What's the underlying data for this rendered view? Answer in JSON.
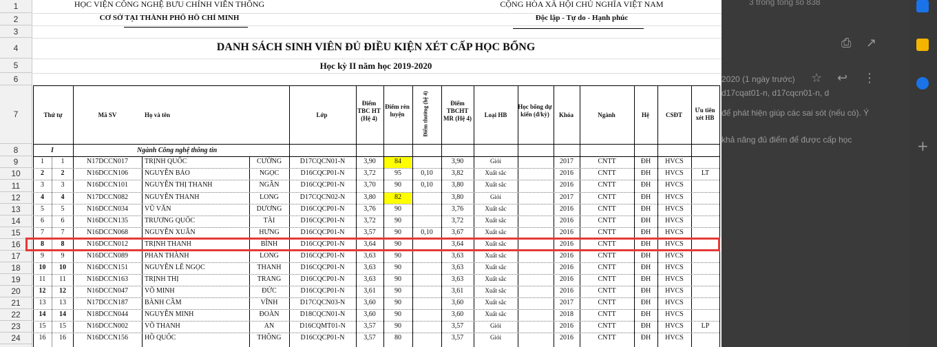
{
  "background": {
    "count_text": "3 trong tổng số 838",
    "date_text": "2020 (1 ngày trước)",
    "recipients_text": "d17cqat01-n, d17cqcn01-n, d",
    "body_line_1": "để phát hiện giúp các sai sót (nếu có). Ý",
    "body_line_2": "khả năng đủ điểm để được cấp học"
  },
  "header": {
    "left_line1": "HỌC VIỆN CÔNG NGHỆ BƯU CHÍNH VIỄN THÔNG",
    "left_line2": "CƠ SỞ TẠI THÀNH PHỐ HỒ CHÍ MINH",
    "right_line1": "CỘNG HÒA XÃ HỘI CHỦ NGHĨA VIỆT NAM",
    "right_line2": "Độc lập - Tự do - Hạnh phúc",
    "title": "DANH SÁCH SINH VIÊN ĐỦ ĐIỀU KIỆN XÉT CẤP HỌC BỔNG",
    "subtitle": "Học kỳ II năm học 2019-2020"
  },
  "row_numbers": [
    "1",
    "2",
    "3",
    "4",
    "5",
    "6",
    "7",
    "8",
    "9",
    "10",
    "11",
    "12",
    "13",
    "14",
    "15",
    "16",
    "17",
    "18",
    "19",
    "20",
    "21",
    "22",
    "23",
    "24"
  ],
  "columns": {
    "stt": "Thứ tự",
    "masv": "Mã SV",
    "hoten": "Họ và tên",
    "lop": "Lớp",
    "diem_tbc": "Điểm TBC HT (Hệ 4)",
    "diem_rl": "Điểm rèn luyện",
    "diem_thuong": "Điểm thưởng (hệ 4)",
    "tbcht": "Điểm TBCHT MR (Hệ 4)",
    "loaihb": "Loại HB",
    "hocbong": "Học bổng dự kiến (đ/kỳ)",
    "khoa": "Khóa",
    "nganh": "Ngành",
    "he": "Hệ",
    "csdt": "CSĐT",
    "uutien": "Ưu tiên xét HB"
  },
  "group_row": {
    "index": "I",
    "label": "Ngành Công nghệ thông tin"
  },
  "rows": [
    {
      "a": "1",
      "b": "1",
      "masv": "N17DCCN017",
      "ho": "TRỊNH QUỐC",
      "ten": "CƯỜNG",
      "lop": "D17CQCN01-N",
      "tbc": "3,90",
      "rl": "84",
      "thuong": "",
      "mr": "3,90",
      "loai": "Giỏi",
      "khoa": "2017",
      "nganh": "CNTT",
      "he": "ĐH",
      "cs": "HVCS",
      "ut": ""
    },
    {
      "a": "2",
      "b": "2",
      "masv": "N16DCCN106",
      "ho": "NGUYỄN BẢO",
      "ten": "NGỌC",
      "lop": "D16CQCP01-N",
      "tbc": "3,72",
      "rl": "95",
      "thuong": "0,10",
      "mr": "3,82",
      "loai": "Xuất sắc",
      "khoa": "2016",
      "nganh": "CNTT",
      "he": "ĐH",
      "cs": "HVCS",
      "ut": "LT"
    },
    {
      "a": "3",
      "b": "3",
      "masv": "N16DCCN101",
      "ho": "NGUYỄN THỊ THANH",
      "ten": "NGÂN",
      "lop": "D16CQCP01-N",
      "tbc": "3,70",
      "rl": "90",
      "thuong": "0,10",
      "mr": "3,80",
      "loai": "Xuất sắc",
      "khoa": "2016",
      "nganh": "CNTT",
      "he": "ĐH",
      "cs": "HVCS",
      "ut": ""
    },
    {
      "a": "4",
      "b": "4",
      "masv": "N17DCCN082",
      "ho": "NGUYỄN THANH",
      "ten": "LONG",
      "lop": "D17CQCN02-N",
      "tbc": "3,80",
      "rl": "82",
      "thuong": "",
      "mr": "3,80",
      "loai": "Giỏi",
      "khoa": "2017",
      "nganh": "CNTT",
      "he": "ĐH",
      "cs": "HVCS",
      "ut": ""
    },
    {
      "a": "5",
      "b": "5",
      "masv": "N16DCCN034",
      "ho": "VŨ VĂN",
      "ten": "DƯƠNG",
      "lop": "D16CQCP01-N",
      "tbc": "3,76",
      "rl": "90",
      "thuong": "",
      "mr": "3,76",
      "loai": "Xuất sắc",
      "khoa": "2016",
      "nganh": "CNTT",
      "he": "ĐH",
      "cs": "HVCS",
      "ut": ""
    },
    {
      "a": "6",
      "b": "6",
      "masv": "N16DCCN135",
      "ho": "TRƯƠNG QUỐC",
      "ten": "TÀI",
      "lop": "D16CQCP01-N",
      "tbc": "3,72",
      "rl": "90",
      "thuong": "",
      "mr": "3,72",
      "loai": "Xuất sắc",
      "khoa": "2016",
      "nganh": "CNTT",
      "he": "ĐH",
      "cs": "HVCS",
      "ut": ""
    },
    {
      "a": "7",
      "b": "7",
      "masv": "N16DCCN068",
      "ho": "NGUYỄN XUÂN",
      "ten": "HƯNG",
      "lop": "D16CQCP01-N",
      "tbc": "3,57",
      "rl": "90",
      "thuong": "0,10",
      "mr": "3,67",
      "loai": "Xuất sắc",
      "khoa": "2016",
      "nganh": "CNTT",
      "he": "ĐH",
      "cs": "HVCS",
      "ut": ""
    },
    {
      "a": "8",
      "b": "8",
      "masv": "N16DCCN012",
      "ho": "TRỊNH THANH",
      "ten": "BÌNH",
      "lop": "D16CQCP01-N",
      "tbc": "3,64",
      "rl": "90",
      "thuong": "",
      "mr": "3,64",
      "loai": "Xuất sắc",
      "khoa": "2016",
      "nganh": "CNTT",
      "he": "ĐH",
      "cs": "HVCS",
      "ut": ""
    },
    {
      "a": "9",
      "b": "9",
      "masv": "N16DCCN089",
      "ho": "PHAN THÀNH",
      "ten": "LONG",
      "lop": "D16CQCP01-N",
      "tbc": "3,63",
      "rl": "90",
      "thuong": "",
      "mr": "3,63",
      "loai": "Xuất sắc",
      "khoa": "2016",
      "nganh": "CNTT",
      "he": "ĐH",
      "cs": "HVCS",
      "ut": ""
    },
    {
      "a": "10",
      "b": "10",
      "masv": "N16DCCN151",
      "ho": "NGUYỄN LÊ NGỌC",
      "ten": "THANH",
      "lop": "D16CQCP01-N",
      "tbc": "3,63",
      "rl": "90",
      "thuong": "",
      "mr": "3,63",
      "loai": "Xuất sắc",
      "khoa": "2016",
      "nganh": "CNTT",
      "he": "ĐH",
      "cs": "HVCS",
      "ut": ""
    },
    {
      "a": "11",
      "b": "11",
      "masv": "N16DCCN163",
      "ho": "TRỊNH THỊ",
      "ten": "TRANG",
      "lop": "D16CQCP01-N",
      "tbc": "3,63",
      "rl": "90",
      "thuong": "",
      "mr": "3,63",
      "loai": "Xuất sắc",
      "khoa": "2016",
      "nganh": "CNTT",
      "he": "ĐH",
      "cs": "HVCS",
      "ut": ""
    },
    {
      "a": "12",
      "b": "12",
      "masv": "N16DCCN047",
      "ho": "VÕ MINH",
      "ten": "ĐỨC",
      "lop": "D16CQCP01-N",
      "tbc": "3,61",
      "rl": "90",
      "thuong": "",
      "mr": "3,61",
      "loai": "Xuất sắc",
      "khoa": "2016",
      "nganh": "CNTT",
      "he": "ĐH",
      "cs": "HVCS",
      "ut": ""
    },
    {
      "a": "13",
      "b": "13",
      "masv": "N17DCCN187",
      "ho": "BÀNH CẦM",
      "ten": "VĨNH",
      "lop": "D17CQCN03-N",
      "tbc": "3,60",
      "rl": "90",
      "thuong": "",
      "mr": "3,60",
      "loai": "Xuất sắc",
      "khoa": "2017",
      "nganh": "CNTT",
      "he": "ĐH",
      "cs": "HVCS",
      "ut": ""
    },
    {
      "a": "14",
      "b": "14",
      "masv": "N18DCCN044",
      "ho": "NGUYỄN MINH",
      "ten": "ĐOÀN",
      "lop": "D18CQCN01-N",
      "tbc": "3,60",
      "rl": "90",
      "thuong": "",
      "mr": "3,60",
      "loai": "Xuất sắc",
      "khoa": "2018",
      "nganh": "CNTT",
      "he": "ĐH",
      "cs": "HVCS",
      "ut": ""
    },
    {
      "a": "15",
      "b": "15",
      "masv": "N16DCCN002",
      "ho": "VÕ THANH",
      "ten": "AN",
      "lop": "D16CQMT01-N",
      "tbc": "3,57",
      "rl": "90",
      "thuong": "",
      "mr": "3,57",
      "loai": "Giỏi",
      "khoa": "2016",
      "nganh": "CNTT",
      "he": "ĐH",
      "cs": "HVCS",
      "ut": "LP"
    },
    {
      "a": "16",
      "b": "16",
      "masv": "N16DCCN156",
      "ho": "HỒ QUỐC",
      "ten": "THÔNG",
      "lop": "D16CQCP01-N",
      "tbc": "3,57",
      "rl": "80",
      "thuong": "",
      "mr": "3,57",
      "loai": "Giỏi",
      "khoa": "2016",
      "nganh": "CNTT",
      "he": "ĐH",
      "cs": "HVCS",
      "ut": ""
    }
  ],
  "highlight_colors": {
    "yellow": "#ffff00",
    "selection": "#e53935"
  }
}
